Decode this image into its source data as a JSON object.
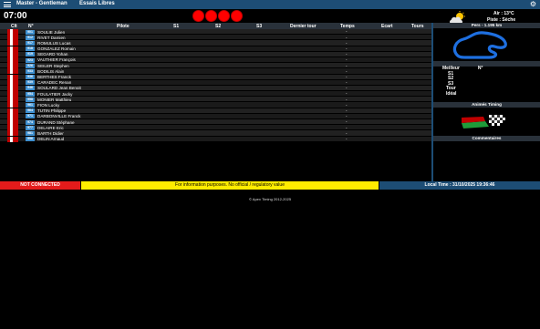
{
  "topbar": {
    "title": "Master - Gentleman",
    "session": "Essais Libres",
    "menu_icon": "menu-icon",
    "settings_icon": "gear-icon"
  },
  "clock": "07:00",
  "lights": {
    "count": 4,
    "color": "#ff0000"
  },
  "weather": {
    "icon": "partly-cloudy-icon",
    "air": "Air : 13°C",
    "track": "Piste : Sèche"
  },
  "table": {
    "headers": {
      "clt": "Clt",
      "num": "N°",
      "pilot": "Pilote",
      "s1": "S1",
      "s2": "S2",
      "s3": "S3",
      "last_lap": "Dernier tour",
      "time": "Temps",
      "gap": "Ecart",
      "laps": "Tours"
    },
    "rows": [
      {
        "num": "901",
        "pilot": "SOULIE Julien",
        "time": "-"
      },
      {
        "num": "912",
        "pilot": "RIVET Damien",
        "time": "-"
      },
      {
        "num": "917",
        "pilot": "ROMULUS Lucas",
        "time": "-"
      },
      {
        "num": "918",
        "pilot": "GONZALEZ Romain",
        "time": "-"
      },
      {
        "num": "919",
        "pilot": "SEGARD Yohan",
        "time": "-"
      },
      {
        "num": "923",
        "pilot": "VAUTHIER François",
        "time": "-"
      },
      {
        "num": "926",
        "pilot": "SEILER Stephen",
        "time": "-"
      },
      {
        "num": "933",
        "pilot": "BODILIS Alain",
        "time": "-"
      },
      {
        "num": "936",
        "pilot": "BERTHES Franck",
        "time": "-"
      },
      {
        "num": "939",
        "pilot": "CARADEC Renan",
        "time": "-"
      },
      {
        "num": "946",
        "pilot": "SOULARD Jean Benoit",
        "time": "-"
      },
      {
        "num": "954",
        "pilot": "FOULATIER Jacky",
        "time": "-"
      },
      {
        "num": "958",
        "pilot": "MONIER Matthieu",
        "time": "-"
      },
      {
        "num": "961",
        "pilot": "FION Lucky",
        "time": "-"
      },
      {
        "num": "964",
        "pilot": "TUTIN Philippe",
        "time": "-"
      },
      {
        "num": "971",
        "pilot": "DARBONVILLE Franck",
        "time": "-"
      },
      {
        "num": "974",
        "pilot": "DURAND Stéphane",
        "time": "-"
      },
      {
        "num": "977",
        "pilot": "DELAIRE Eric",
        "time": "-"
      },
      {
        "num": "981",
        "pilot": "BARTH Didier",
        "time": "-"
      },
      {
        "num": "996",
        "pilot": "DELIN Arnaud",
        "time": "-"
      }
    ]
  },
  "side": {
    "track_title": "Pers - 1.195 km",
    "best_header": "Meilleur",
    "best_num_header": "N°",
    "best_items": [
      "S1",
      "S2",
      "S3",
      "Tour",
      "Idéal"
    ],
    "animation_title": "Animés Timing",
    "comments_title": "Commentaires"
  },
  "status": {
    "connection": "NOT CONNECTED",
    "info": "For information purposes. No official / regulatory value",
    "local_time": "Local Time : 31/10/2025 19:36:46"
  },
  "copyright": "© Apex Timing 2012-2025",
  "colors": {
    "topbar": "#1d4d75",
    "not_connected": "#e31b1b",
    "info_bar": "#ffec00",
    "number_badge": "#3d8fcf"
  }
}
